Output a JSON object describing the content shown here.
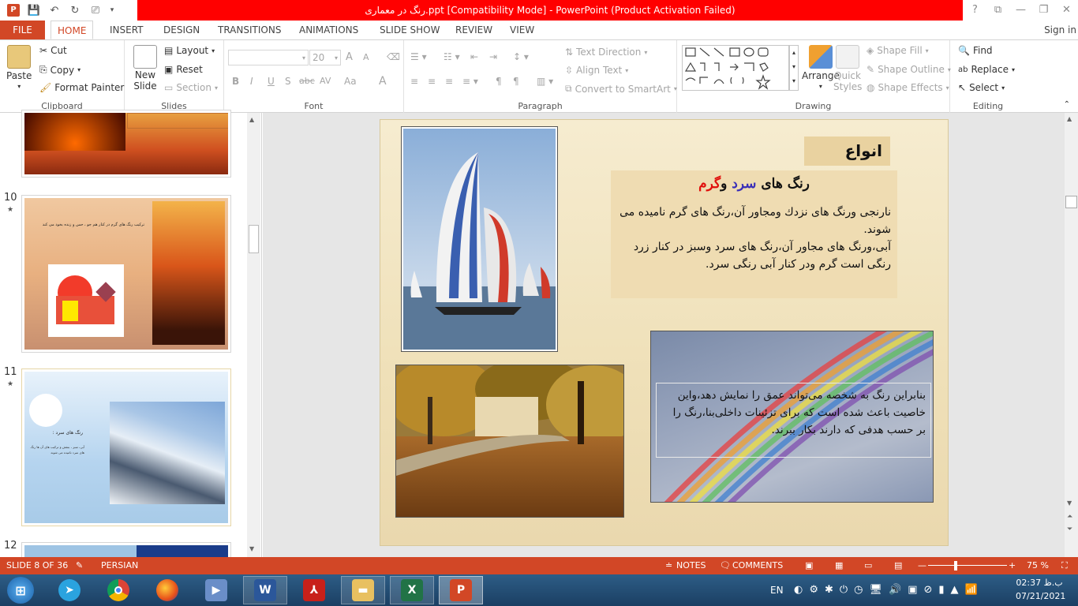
{
  "titlebar": {
    "title": "رنگ در معماری.ppt [Compatibility Mode] - PowerPoint (Product Activation Failed)",
    "help": "?",
    "ribbon_display": "⧉",
    "minimize": "—",
    "restore": "❐",
    "close": "✕"
  },
  "tabs": {
    "file": "FILE",
    "items": [
      "HOME",
      "INSERT",
      "DESIGN",
      "TRANSITIONS",
      "ANIMATIONS",
      "SLIDE SHOW",
      "REVIEW",
      "VIEW"
    ],
    "signin": "Sign in"
  },
  "ribbon": {
    "clipboard": {
      "label": "Clipboard",
      "paste": "Paste",
      "cut": "Cut",
      "copy": "Copy",
      "format_painter": "Format Painter"
    },
    "slides": {
      "label": "Slides",
      "new_slide": "New Slide",
      "layout": "Layout",
      "reset": "Reset",
      "section": "Section"
    },
    "font": {
      "label": "Font",
      "size": "20",
      "bold": "B",
      "italic": "I",
      "underline": "U",
      "shadow": "S",
      "strike": "abc",
      "spacing": "AV",
      "case": "Aa",
      "color": "A",
      "grow": "A",
      "shrink": "A"
    },
    "paragraph": {
      "label": "Paragraph",
      "text_direction": "Text Direction",
      "align_text": "Align Text",
      "smartart": "Convert to SmartArt"
    },
    "drawing": {
      "label": "Drawing",
      "arrange": "Arrange",
      "quick_styles": "Quick Styles",
      "shape_fill": "Shape Fill",
      "shape_outline": "Shape Outline",
      "shape_effects": "Shape Effects"
    },
    "editing": {
      "label": "Editing",
      "find": "Find",
      "replace": "Replace",
      "select": "Select"
    }
  },
  "thumbnails": [
    {
      "number": "10",
      "title": "ترکیب رنگ های گرم در کنار هم جو ، حس و زنده بخود می کند"
    },
    {
      "number": "11",
      "title": "رنگ های سرد :",
      "body": "آبی، سبز ، بنفش و ترکیب های آن ها رنگ های سرد نامیده می شوند"
    },
    {
      "number": "12"
    }
  ],
  "slide": {
    "heading": "انواع رنگ:",
    "subtitle_a": "رنگ های ",
    "subtitle_cold": "سرد",
    "subtitle_and": " و",
    "subtitle_warm": "گرم",
    "para1": "نارنجی ورنگ های نزدك ومجاور آن،رنگ های گرم نامیده می شوند.",
    "para2": "آبی،ورنگ های مجاور آن،رنگ های سرد وسبز در كنار زرد رنگی است گرم ودر كنار آبی رنگی سرد.",
    "rainbow_text": "بنابراین رنگ به شخصه می‌تواند عمق را نمایش دهد،واین خاصیت باعث شده است که برای تزئینات داخلی‌بنا،رنگ را بر حسب هدفی که دارند بکار ببرند.",
    "colors": {
      "cold": "#3a2fb8",
      "warm": "#e0100c"
    }
  },
  "status": {
    "slide": "SLIDE 8 OF 36",
    "language": "PERSIAN",
    "notes": "NOTES",
    "comments": "COMMENTS",
    "zoom": "75 %"
  },
  "taskbar": {
    "lang": "EN",
    "time": "02:37 ب.ظ",
    "date": "07/21/2021"
  }
}
